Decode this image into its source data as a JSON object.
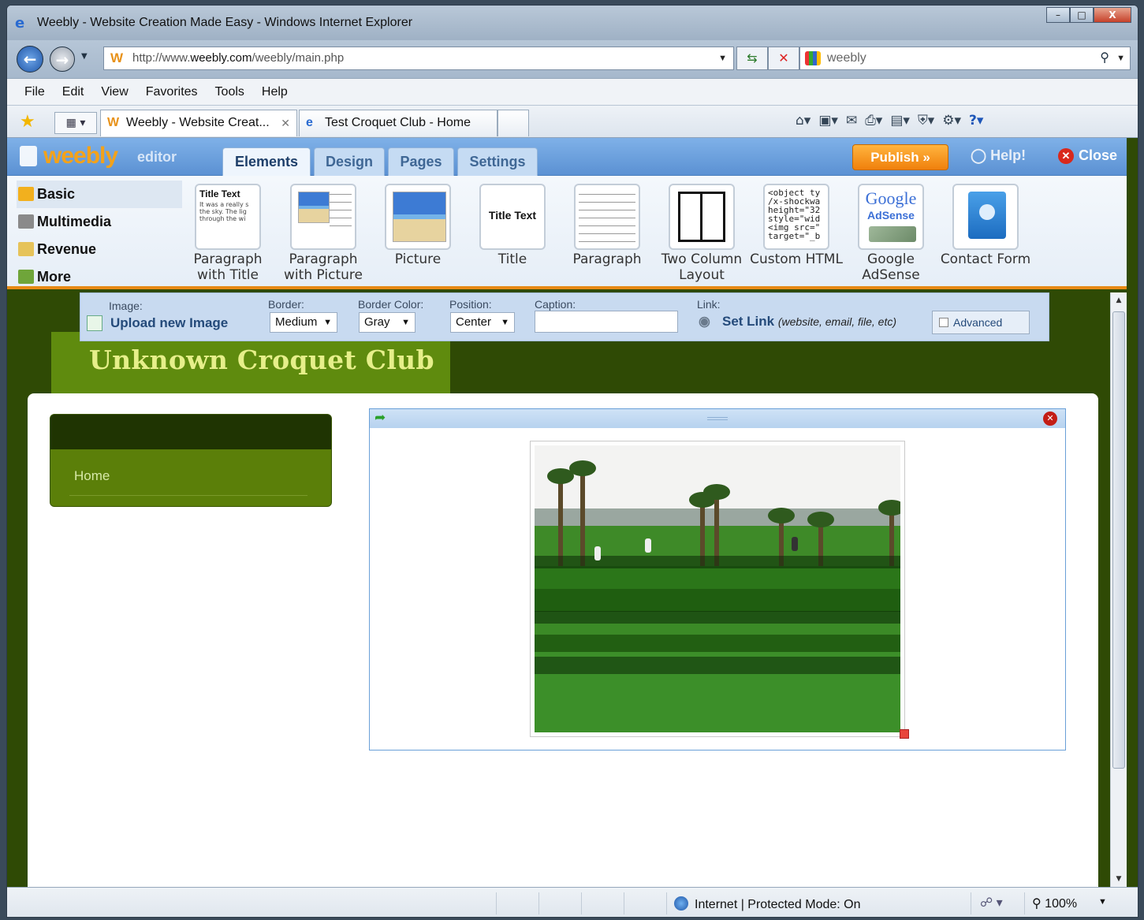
{
  "window": {
    "title": "Weebly - Website Creation Made Easy - Windows Internet Explorer",
    "controls": {
      "minimize": "–",
      "maximize": "□",
      "close": "X"
    }
  },
  "address": {
    "url_prefix": "http://www.",
    "url_domain": "weebly.com",
    "url_path": "/weebly/main.php",
    "favicon": "W",
    "search_text": "weebly"
  },
  "menu": [
    "File",
    "Edit",
    "View",
    "Favorites",
    "Tools",
    "Help"
  ],
  "tabs": [
    {
      "label": "Weebly - Website Creat...",
      "icon": "W",
      "active": true
    },
    {
      "label": "Test Croquet Club - Home",
      "icon": "e",
      "active": false
    }
  ],
  "toolbar_icons": [
    "home-icon",
    "feeds-icon",
    "mail-icon",
    "print-icon",
    "page-icon",
    "safety-icon",
    "tools-icon",
    "help-icon"
  ],
  "editor": {
    "logo": "weebly",
    "logo_sub": "editor",
    "tabs": [
      "Elements",
      "Design",
      "Pages",
      "Settings"
    ],
    "active_tab": "Elements",
    "publish": "Publish »",
    "help": "Help!",
    "close": "Close",
    "accent_color": "#f0800c"
  },
  "categories": [
    {
      "label": "Basic",
      "selected": true
    },
    {
      "label": "Multimedia",
      "selected": false
    },
    {
      "label": "Revenue",
      "selected": false
    },
    {
      "label": "More",
      "selected": false
    }
  ],
  "elements": [
    {
      "label": "Paragraph with Title",
      "thumb_title": "Title Text",
      "thumb_text": "It was a really s the sky. The lig through the wi"
    },
    {
      "label": "Paragraph with Picture"
    },
    {
      "label": "Picture"
    },
    {
      "label": "Title",
      "thumb_title": "Title Text"
    },
    {
      "label": "Paragraph"
    },
    {
      "label": "Two Column Layout"
    },
    {
      "label": "Custom HTML",
      "thumb_code": "<object ty\n/x-shockwa\nheight=\"32\nstyle=\"wid\n<img src=\"\ntarget=\"_b"
    },
    {
      "label": "Google AdSense",
      "thumb_google": "Google",
      "thumb_adsense": "AdSense"
    },
    {
      "label": "Contact Form"
    }
  ],
  "image_toolbar": {
    "image_label": "Image:",
    "upload": "Upload new Image",
    "border_label": "Border:",
    "border_value": "Medium",
    "border_color_label": "Border Color:",
    "border_color_value": "Gray",
    "position_label": "Position:",
    "position_value": "Center",
    "caption_label": "Caption:",
    "caption_value": "",
    "link_label": "Link:",
    "set_link": "Set Link",
    "set_link_hint": "(website, email, file, etc)",
    "advanced": "Advanced"
  },
  "site": {
    "title": "Unknown Croquet Club",
    "nav": [
      "Home"
    ]
  },
  "status": {
    "zone": "Internet | Protected Mode: On",
    "zoom": "100%"
  }
}
